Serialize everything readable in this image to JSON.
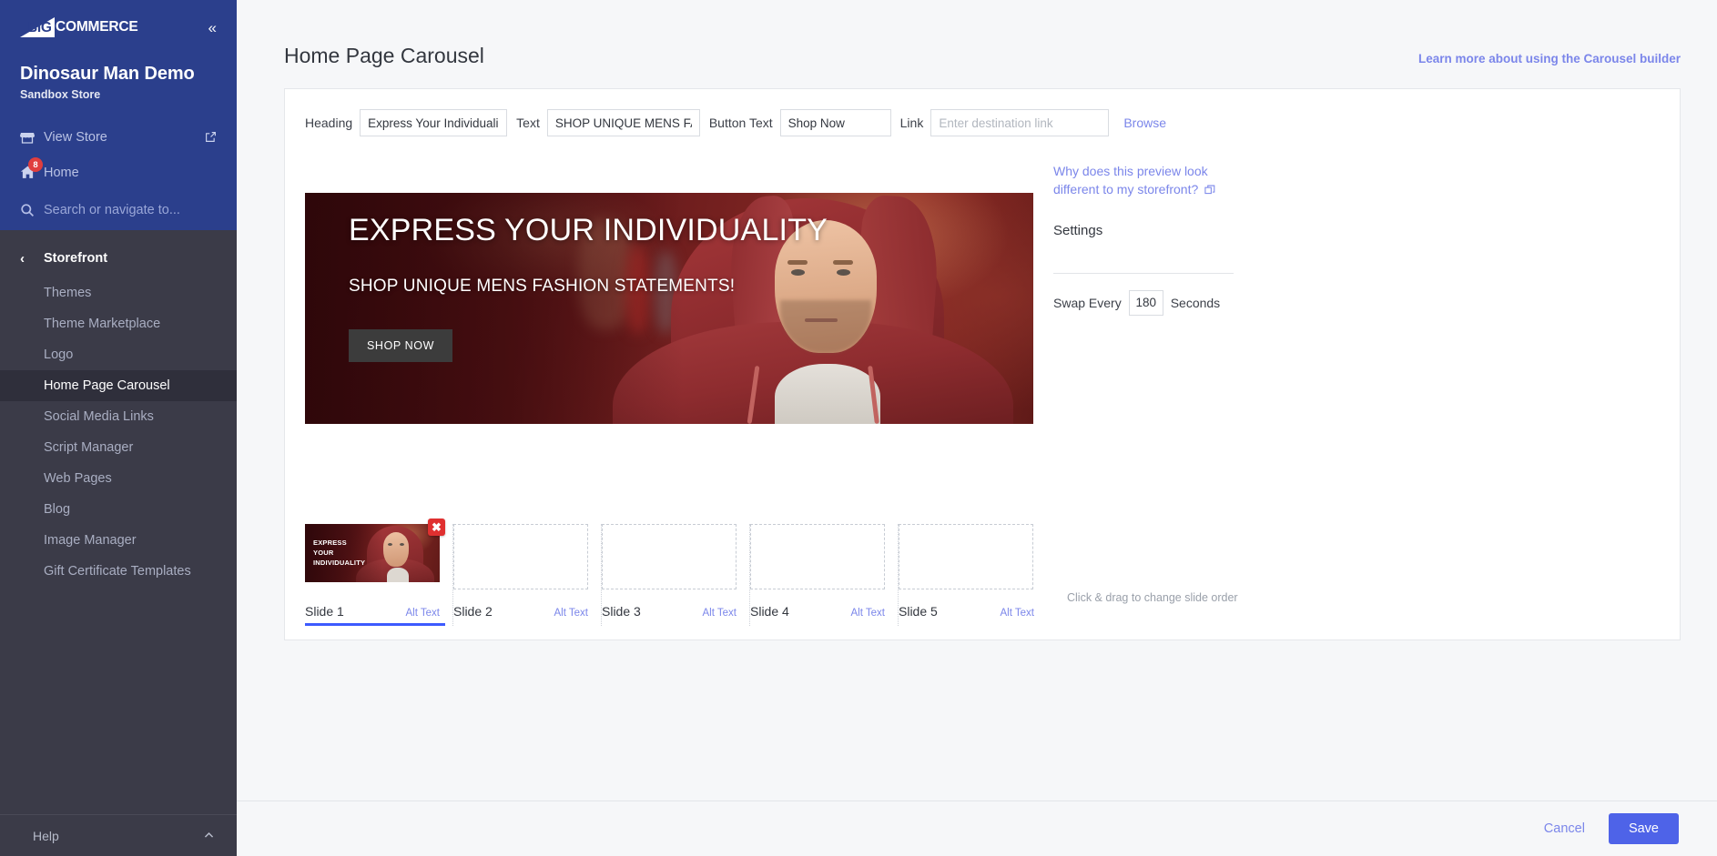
{
  "sidebar": {
    "logo": {
      "mark_text": "BIG",
      "word": "COMMERCE",
      "collapse_icon": "chevron-double-left-icon"
    },
    "store_name": "Dinosaur Man Demo",
    "store_plan": "Sandbox Store",
    "view_store": {
      "label": "View Store",
      "icon": "storefront-icon",
      "external_icon": "external-link-icon"
    },
    "home": {
      "label": "Home",
      "icon": "home-icon",
      "badge": "8"
    },
    "search": {
      "placeholder": "Search or navigate to...",
      "icon": "search-icon"
    },
    "section": {
      "label": "Storefront",
      "back_icon": "chevron-left-icon"
    },
    "items": [
      {
        "label": "Themes",
        "active": false
      },
      {
        "label": "Theme Marketplace",
        "active": false
      },
      {
        "label": "Logo",
        "active": false
      },
      {
        "label": "Home Page Carousel",
        "active": true
      },
      {
        "label": "Social Media Links",
        "active": false
      },
      {
        "label": "Script Manager",
        "active": false
      },
      {
        "label": "Web Pages",
        "active": false
      },
      {
        "label": "Blog",
        "active": false
      },
      {
        "label": "Image Manager",
        "active": false
      },
      {
        "label": "Gift Certificate Templates",
        "active": false
      }
    ],
    "help": {
      "label": "Help",
      "icon": "chevron-up-icon"
    }
  },
  "page": {
    "title": "Home Page Carousel",
    "learn_more": "Learn more about using the Carousel builder"
  },
  "toolbar": {
    "heading_label": "Heading",
    "heading_value": "Express Your Individuali",
    "text_label": "Text",
    "text_value": "SHOP UNIQUE MENS FA",
    "button_text_label": "Button Text",
    "button_text_value": "Shop Now",
    "link_label": "Link",
    "link_placeholder": "Enter destination link",
    "browse_label": "Browse"
  },
  "preview": {
    "heading": "EXPRESS YOUR INDIVIDUALITY",
    "text": "SHOP UNIQUE MENS FASHION STATEMENTS!",
    "button": "SHOP NOW"
  },
  "settings": {
    "why_link": "Why does this preview look different to my storefront?",
    "why_link_icon": "popout-window-icon",
    "title": "Settings",
    "swap_every_label": "Swap Every",
    "swap_every_value": "180",
    "seconds_label": "Seconds"
  },
  "slides": {
    "drag_hint": "Click & drag to change slide order",
    "alt_text_label": "Alt Text",
    "delete_icon": "close-x-icon",
    "thumb_caption": "EXPRESS\nYOUR\nINDIVIDUALITY",
    "items": [
      {
        "name": "Slide 1",
        "has_image": true,
        "active": true
      },
      {
        "name": "Slide 2",
        "has_image": false,
        "active": false
      },
      {
        "name": "Slide 3",
        "has_image": false,
        "active": false
      },
      {
        "name": "Slide 4",
        "has_image": false,
        "active": false
      },
      {
        "name": "Slide 5",
        "has_image": false,
        "active": false
      }
    ]
  },
  "footer": {
    "cancel": "Cancel",
    "save": "Save"
  },
  "colors": {
    "sidebar_top": "#2b3f8c",
    "sidebar_nav": "#3b3b48",
    "accent_link": "#7b86ea",
    "save_button": "#4e63e8",
    "active_tab_underline": "#3d5afe",
    "delete_badge": "#e03030",
    "home_badge": "#e03e3e"
  }
}
